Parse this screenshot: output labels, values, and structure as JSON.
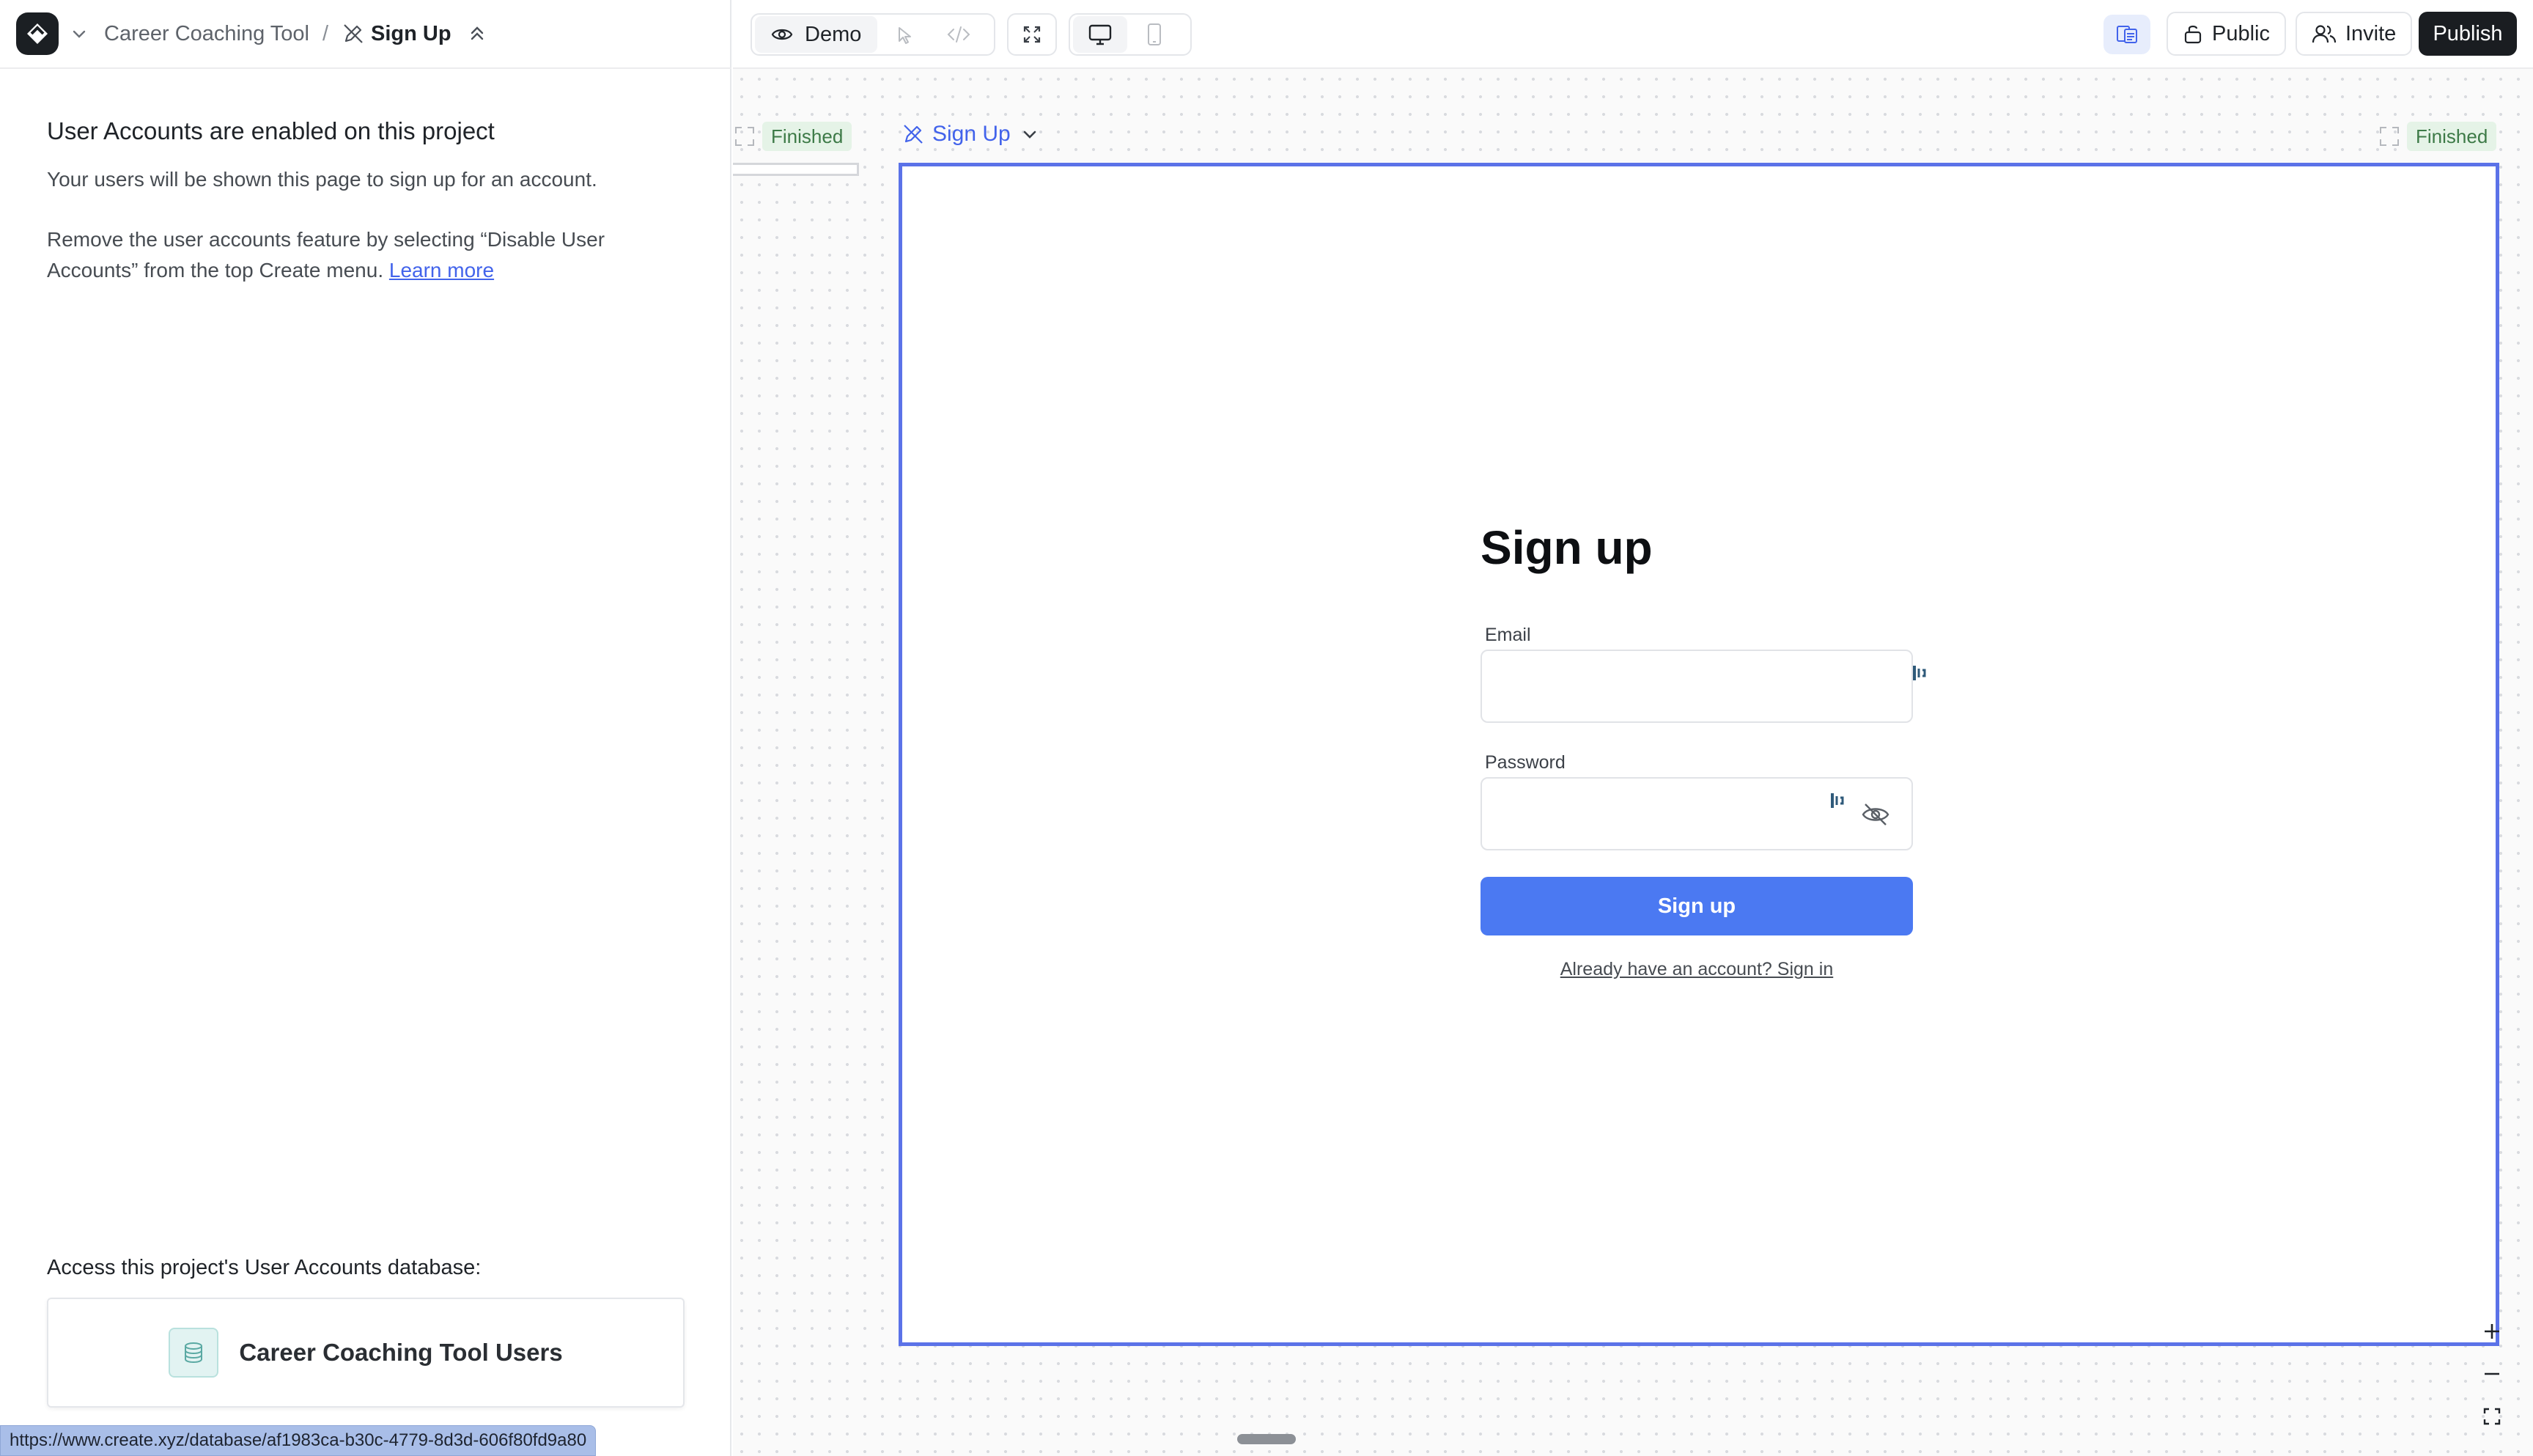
{
  "breadcrumb": {
    "project": "Career Coaching Tool",
    "separator": "/",
    "page": "Sign Up"
  },
  "notice": {
    "title": "User Accounts are enabled on this project",
    "line1": "Your users will be shown this page to sign up for an account.",
    "line2": "Remove the user accounts feature by selecting “Disable User Accounts” from the top Create menu.",
    "learn_more": "Learn more"
  },
  "database": {
    "label": "Access this project's User Accounts database:",
    "name": "Career Coaching Tool Users"
  },
  "status_url": "https://www.create.xyz/database/af1983ca-b30c-4779-8d3d-606f80fd9a80",
  "toolbar": {
    "demo_label": "Demo",
    "public_label": "Public",
    "invite_label": "Invite",
    "publish_label": "Publish"
  },
  "canvas": {
    "finished_left": "Finished",
    "finished_right": "Finished",
    "frame_title": "Sign Up"
  },
  "signup_form": {
    "title": "Sign up",
    "email_label": "Email",
    "email_value": "",
    "password_label": "Password",
    "password_value": "",
    "submit_label": "Sign up",
    "signin_link": "Already have an account? Sign in"
  },
  "colors": {
    "accent": "#4b79f2",
    "frame_border": "#5b72e8",
    "finished_bg": "#e5f3e7",
    "finished_text": "#3d7a47",
    "publish_bg": "#1a1d21"
  },
  "icons": {
    "logo": "create-logo-icon",
    "chevron": "chevron-down-icon",
    "page": "pen-slash-icon",
    "collapse": "chevrons-up-icon",
    "demo": "eye-icon",
    "select": "cursor-icon",
    "code": "code-icon",
    "fullscreen": "expand-icon",
    "desktop": "monitor-icon",
    "mobile": "phone-icon",
    "fonts": "fonts-icon",
    "public": "lock-open-icon",
    "invite": "users-icon",
    "database": "database-icon",
    "password_toggle": "eye-off-icon",
    "zoom_in": "plus-icon",
    "zoom_out": "minus-icon",
    "fit": "fit-screen-icon"
  }
}
